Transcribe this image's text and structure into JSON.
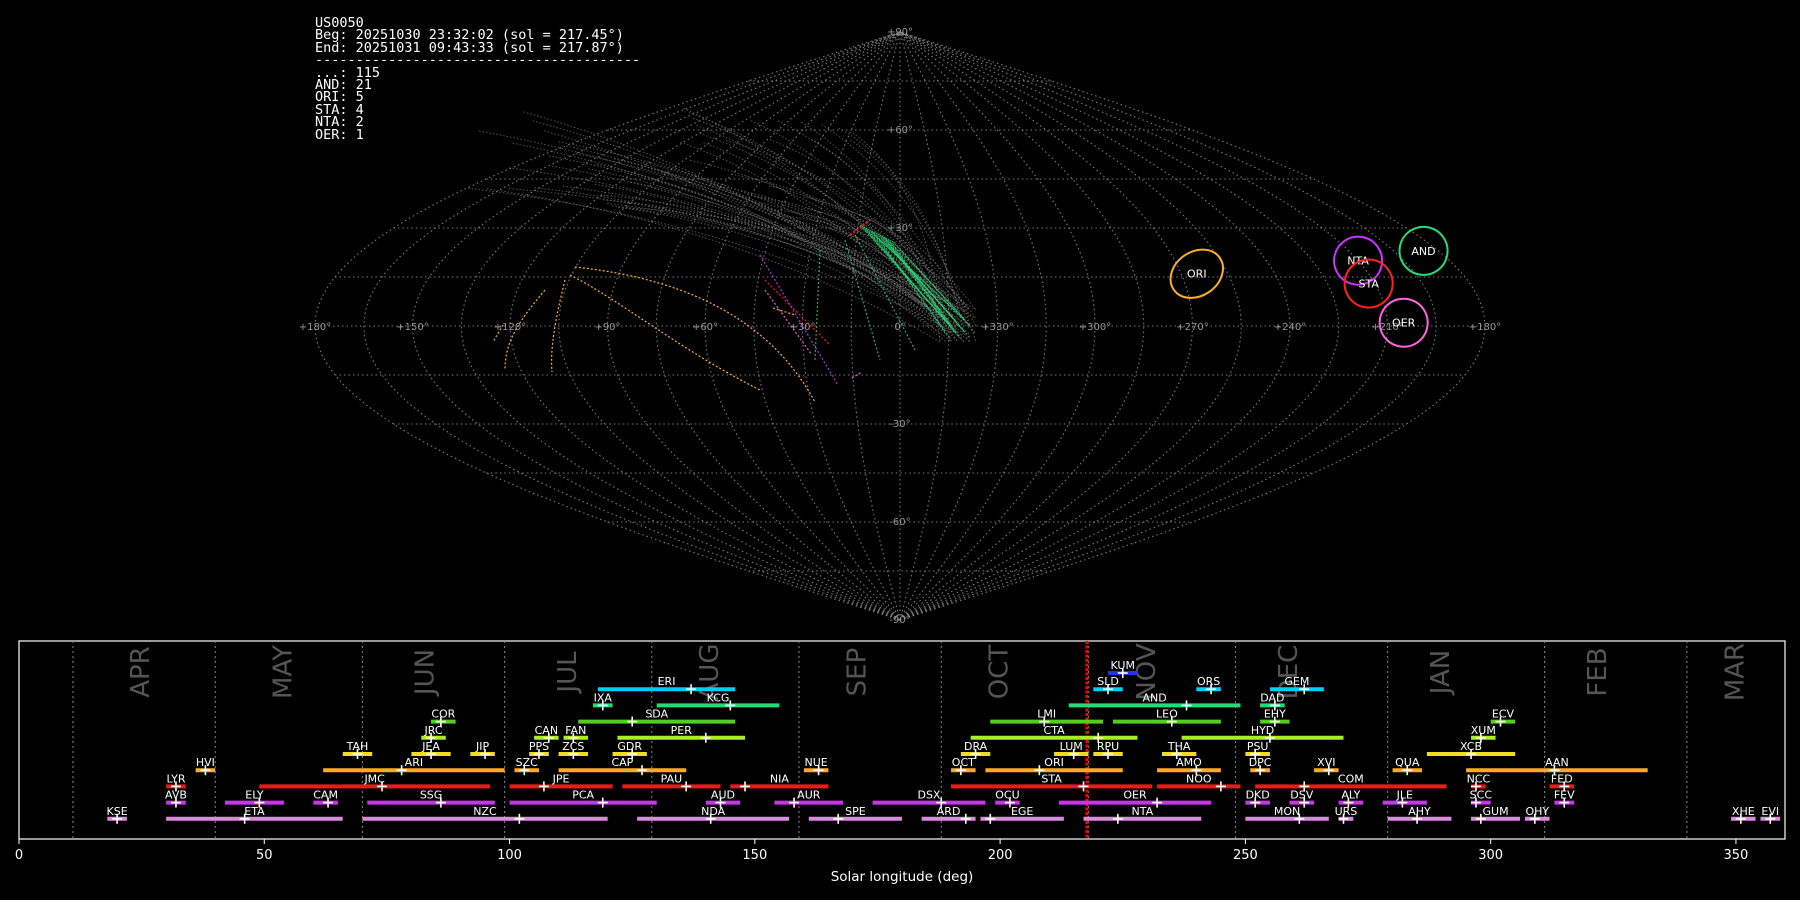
{
  "info_panel": {
    "station": "US0050",
    "begin": "Beg: 20251030 23:32:02 (sol = 217.45°)",
    "end": "End: 20251031 09:43:33 (sol = 217.87°)",
    "separator": "----------------------------------------",
    "counts": [
      {
        "code": "...",
        "count": 115
      },
      {
        "code": "AND",
        "count": 21
      },
      {
        "code": "ORI",
        "count": 5
      },
      {
        "code": "STA",
        "count": 4
      },
      {
        "code": "NTA",
        "count": 2
      },
      {
        "code": "OER",
        "count": 1
      }
    ]
  },
  "colors": {
    "background": "#000000",
    "grid": "#7a7a7a",
    "axis_text": "#ffffff",
    "month_label": "#555555",
    "current_marker": "#ff0000"
  },
  "sky_map": {
    "projection": "sinusoidal",
    "lon_ticks": [
      "+180°",
      "+150°",
      "+120°",
      "+90°",
      "+60°",
      "+30°",
      "0°",
      "+330°",
      "+300°",
      "+270°",
      "+240°",
      "+210°",
      "+180°"
    ],
    "lat_ticks": [
      "+90°",
      "+60°",
      "+30°",
      "-30°",
      "-60°",
      "-90°"
    ],
    "radiants": [
      {
        "code": "ORI",
        "color": "#ffb020",
        "lon": 100,
        "lat": 16,
        "r": 12
      },
      {
        "code": "NTA",
        "color": "#cc33ff",
        "lon": 45,
        "lat": 20,
        "r": 8
      },
      {
        "code": "STA",
        "color": "#ff2020",
        "lon": 47,
        "lat": 13,
        "r": 8
      },
      {
        "code": "AND",
        "color": "#22dd77",
        "lon": 20,
        "lat": 23,
        "r": 8
      },
      {
        "code": "OER",
        "color": "#ff66dd",
        "lon": 40,
        "lat": 1,
        "r": 8
      }
    ]
  },
  "chart_data": {
    "type": "bar",
    "title": "",
    "xlabel": "Solar longitude (deg)",
    "xlim": [
      0,
      360
    ],
    "x_ticks": [
      0,
      50,
      100,
      150,
      200,
      250,
      300,
      350
    ],
    "current_sol": 217.7,
    "months": [
      {
        "label": "APR",
        "x": 25
      },
      {
        "label": "MAY",
        "x": 54
      },
      {
        "label": "JUN",
        "x": 83
      },
      {
        "label": "JUL",
        "x": 112
      },
      {
        "label": "AUG",
        "x": 141
      },
      {
        "label": "SEP",
        "x": 171
      },
      {
        "label": "OCT",
        "x": 200
      },
      {
        "label": "NOV",
        "x": 230
      },
      {
        "label": "DEC",
        "x": 259
      },
      {
        "label": "JAN",
        "x": 290
      },
      {
        "label": "FEB",
        "x": 322
      },
      {
        "label": "MAR",
        "x": 350
      }
    ],
    "month_separators": [
      11,
      40,
      70,
      99,
      129,
      159,
      188,
      218,
      248,
      279,
      311,
      340
    ],
    "series": [
      {
        "name": "KUM",
        "start": 222,
        "end": 228,
        "peak": 225,
        "row": 10,
        "color": "#2233ee"
      },
      {
        "name": "ERI",
        "start": 118,
        "end": 146,
        "peak": 137,
        "row": 9,
        "color": "#00ccff"
      },
      {
        "name": "SLD",
        "start": 219,
        "end": 225,
        "peak": 222,
        "row": 9,
        "color": "#00ccff"
      },
      {
        "name": "ORS",
        "start": 240,
        "end": 245,
        "peak": 243,
        "row": 9,
        "color": "#00ccff"
      },
      {
        "name": "GEM",
        "start": 255,
        "end": 266,
        "peak": 262,
        "row": 9,
        "color": "#00ccff"
      },
      {
        "name": "IXA",
        "start": 117,
        "end": 121,
        "peak": 119,
        "row": 8,
        "color": "#22dd77"
      },
      {
        "name": "KCG",
        "start": 130,
        "end": 155,
        "peak": 145,
        "row": 8,
        "color": "#22dd77"
      },
      {
        "name": "AND",
        "start": 214,
        "end": 249,
        "peak": 238,
        "row": 8,
        "color": "#22dd77"
      },
      {
        "name": "DAD",
        "start": 253,
        "end": 258,
        "peak": 256,
        "row": 8,
        "color": "#22dd77"
      },
      {
        "name": "COR",
        "start": 84,
        "end": 89,
        "peak": 86,
        "row": 7,
        "color": "#55cc22"
      },
      {
        "name": "SDA",
        "start": 114,
        "end": 146,
        "peak": 125,
        "row": 7,
        "color": "#55cc22"
      },
      {
        "name": "LMI",
        "start": 198,
        "end": 221,
        "peak": 209,
        "row": 7,
        "color": "#55cc22"
      },
      {
        "name": "LEO",
        "start": 223,
        "end": 245,
        "peak": 235,
        "row": 7,
        "color": "#55cc22"
      },
      {
        "name": "EHY",
        "start": 253,
        "end": 259,
        "peak": 256,
        "row": 7,
        "color": "#55cc22"
      },
      {
        "name": "ECV",
        "start": 300,
        "end": 305,
        "peak": 302,
        "row": 7,
        "color": "#55cc22"
      },
      {
        "name": "JRC",
        "start": 82,
        "end": 87,
        "peak": 84,
        "row": 6,
        "color": "#aaee22"
      },
      {
        "name": "CAN",
        "start": 105,
        "end": 110,
        "peak": 108,
        "row": 6,
        "color": "#aaee22"
      },
      {
        "name": "FAN",
        "start": 111,
        "end": 116,
        "peak": 113,
        "row": 6,
        "color": "#aaee22"
      },
      {
        "name": "PER",
        "start": 122,
        "end": 148,
        "peak": 140,
        "row": 6,
        "color": "#aaee22"
      },
      {
        "name": "CTA",
        "start": 194,
        "end": 228,
        "peak": 220,
        "row": 6,
        "color": "#aaee22"
      },
      {
        "name": "HYD",
        "start": 237,
        "end": 270,
        "peak": 255,
        "row": 6,
        "color": "#aaee22"
      },
      {
        "name": "XUM",
        "start": 296,
        "end": 301,
        "peak": 298,
        "row": 6,
        "color": "#aaee22"
      },
      {
        "name": "TAH",
        "start": 66,
        "end": 72,
        "peak": 69,
        "row": 5,
        "color": "#eedd22"
      },
      {
        "name": "JEA",
        "start": 80,
        "end": 88,
        "peak": 84,
        "row": 5,
        "color": "#eedd22"
      },
      {
        "name": "JIP",
        "start": 92,
        "end": 97,
        "peak": 95,
        "row": 5,
        "color": "#eedd22"
      },
      {
        "name": "PPS",
        "start": 104,
        "end": 108,
        "peak": 106,
        "row": 5,
        "color": "#eedd22"
      },
      {
        "name": "ZCS",
        "start": 110,
        "end": 116,
        "peak": 113,
        "row": 5,
        "color": "#eedd22"
      },
      {
        "name": "GDR",
        "start": 121,
        "end": 128,
        "peak": 125,
        "row": 5,
        "color": "#eedd22"
      },
      {
        "name": "DRA",
        "start": 192,
        "end": 198,
        "peak": 195,
        "row": 5,
        "color": "#eedd22"
      },
      {
        "name": "LUM",
        "start": 211,
        "end": 218,
        "peak": 215,
        "row": 5,
        "color": "#eedd22"
      },
      {
        "name": "RPU",
        "start": 219,
        "end": 225,
        "peak": 222,
        "row": 5,
        "color": "#eedd22"
      },
      {
        "name": "THA",
        "start": 233,
        "end": 240,
        "peak": 236,
        "row": 5,
        "color": "#eedd22"
      },
      {
        "name": "PSU",
        "start": 250,
        "end": 255,
        "peak": 252,
        "row": 5,
        "color": "#eedd22"
      },
      {
        "name": "XCB",
        "start": 287,
        "end": 305,
        "peak": 296,
        "row": 5,
        "color": "#eedd22"
      },
      {
        "name": "HVI",
        "start": 36,
        "end": 40,
        "peak": 38,
        "row": 4,
        "color": "#ffaa22"
      },
      {
        "name": "ARI",
        "start": 62,
        "end": 99,
        "peak": 78,
        "row": 4,
        "color": "#ffaa22"
      },
      {
        "name": "SZC",
        "start": 101,
        "end": 106,
        "peak": 103,
        "row": 4,
        "color": "#ffaa22"
      },
      {
        "name": "CAP",
        "start": 110,
        "end": 136,
        "peak": 127,
        "row": 4,
        "color": "#ffaa22"
      },
      {
        "name": "NUE",
        "start": 160,
        "end": 165,
        "peak": 163,
        "row": 4,
        "color": "#ffaa22"
      },
      {
        "name": "OCT",
        "start": 190,
        "end": 195,
        "peak": 192,
        "row": 4,
        "color": "#ffaa22"
      },
      {
        "name": "ORI",
        "start": 197,
        "end": 225,
        "peak": 208,
        "row": 4,
        "color": "#ffaa22"
      },
      {
        "name": "AMO",
        "start": 232,
        "end": 245,
        "peak": 240,
        "row": 4,
        "color": "#ffaa22"
      },
      {
        "name": "DPC",
        "start": 251,
        "end": 255,
        "peak": 253,
        "row": 4,
        "color": "#ffaa22"
      },
      {
        "name": "XVI",
        "start": 264,
        "end": 269,
        "peak": 267,
        "row": 4,
        "color": "#ffaa22"
      },
      {
        "name": "QUA",
        "start": 280,
        "end": 286,
        "peak": 283,
        "row": 4,
        "color": "#ffaa22"
      },
      {
        "name": "AAN",
        "start": 295,
        "end": 332,
        "peak": 313,
        "row": 4,
        "color": "#ffaa22"
      },
      {
        "name": "LYR",
        "start": 30,
        "end": 34,
        "peak": 32,
        "row": 3,
        "color": "#ee1a1a"
      },
      {
        "name": "JMC",
        "start": 49,
        "end": 96,
        "peak": 74,
        "row": 3,
        "color": "#ee1a1a"
      },
      {
        "name": "JPE",
        "start": 100,
        "end": 121,
        "peak": 107,
        "row": 3,
        "color": "#ee1a1a"
      },
      {
        "name": "PAU",
        "start": 123,
        "end": 143,
        "peak": 136,
        "row": 3,
        "color": "#ee1a1a"
      },
      {
        "name": "NIA",
        "start": 145,
        "end": 165,
        "peak": 148,
        "row": 3,
        "color": "#ee1a1a"
      },
      {
        "name": "STA",
        "start": 190,
        "end": 231,
        "peak": 217,
        "row": 3,
        "color": "#ee1a1a"
      },
      {
        "name": "NOO",
        "start": 232,
        "end": 249,
        "peak": 245,
        "row": 3,
        "color": "#ee1a1a"
      },
      {
        "name": "COM",
        "start": 252,
        "end": 291,
        "peak": 262,
        "row": 3,
        "color": "#ee1a1a"
      },
      {
        "name": "NCC",
        "start": 296,
        "end": 299,
        "peak": 297,
        "row": 3,
        "color": "#ee1a1a"
      },
      {
        "name": "FED",
        "start": 312,
        "end": 317,
        "peak": 315,
        "row": 3,
        "color": "#ee1a1a"
      },
      {
        "name": "AVB",
        "start": 30,
        "end": 34,
        "peak": 32,
        "row": 2,
        "color": "#cc33ee"
      },
      {
        "name": "ELY",
        "start": 42,
        "end": 54,
        "peak": 49,
        "row": 2,
        "color": "#cc33ee"
      },
      {
        "name": "CAM",
        "start": 60,
        "end": 65,
        "peak": 63,
        "row": 2,
        "color": "#cc33ee"
      },
      {
        "name": "SSG",
        "start": 71,
        "end": 97,
        "peak": 86,
        "row": 2,
        "color": "#cc33ee"
      },
      {
        "name": "PCA",
        "start": 100,
        "end": 130,
        "peak": 119,
        "row": 2,
        "color": "#cc33ee"
      },
      {
        "name": "AUD",
        "start": 140,
        "end": 147,
        "peak": 143,
        "row": 2,
        "color": "#cc33ee"
      },
      {
        "name": "AUR",
        "start": 154,
        "end": 168,
        "peak": 158,
        "row": 2,
        "color": "#cc33ee"
      },
      {
        "name": "DSX",
        "start": 174,
        "end": 197,
        "peak": 188,
        "row": 2,
        "color": "#cc33ee"
      },
      {
        "name": "OCU",
        "start": 199,
        "end": 204,
        "peak": 202,
        "row": 2,
        "color": "#cc33ee"
      },
      {
        "name": "OER",
        "start": 212,
        "end": 243,
        "peak": 232,
        "row": 2,
        "color": "#cc33ee"
      },
      {
        "name": "DKD",
        "start": 250,
        "end": 255,
        "peak": 252,
        "row": 2,
        "color": "#cc33ee"
      },
      {
        "name": "DSV",
        "start": 259,
        "end": 264,
        "peak": 262,
        "row": 2,
        "color": "#cc33ee"
      },
      {
        "name": "ALY",
        "start": 269,
        "end": 274,
        "peak": 271,
        "row": 2,
        "color": "#cc33ee"
      },
      {
        "name": "JLE",
        "start": 278,
        "end": 287,
        "peak": 282,
        "row": 2,
        "color": "#cc33ee"
      },
      {
        "name": "SCC",
        "start": 296,
        "end": 300,
        "peak": 297,
        "row": 2,
        "color": "#cc33ee"
      },
      {
        "name": "FEV",
        "start": 313,
        "end": 317,
        "peak": 315,
        "row": 2,
        "color": "#cc33ee"
      },
      {
        "name": "KSE",
        "start": 18,
        "end": 22,
        "peak": 20,
        "row": 1,
        "color": "#dd88dd"
      },
      {
        "name": "ETA",
        "start": 30,
        "end": 66,
        "peak": 46,
        "row": 1,
        "color": "#dd88dd"
      },
      {
        "name": "NZC",
        "start": 70,
        "end": 120,
        "peak": 102,
        "row": 1,
        "color": "#dd88dd"
      },
      {
        "name": "NDA",
        "start": 126,
        "end": 157,
        "peak": 141,
        "row": 1,
        "color": "#dd88dd"
      },
      {
        "name": "SPE",
        "start": 161,
        "end": 180,
        "peak": 167,
        "row": 1,
        "color": "#dd88dd"
      },
      {
        "name": "ARD",
        "start": 184,
        "end": 195,
        "peak": 193,
        "row": 1,
        "color": "#dd88dd"
      },
      {
        "name": "EGE",
        "start": 196,
        "end": 213,
        "peak": 198,
        "row": 1,
        "color": "#dd88dd"
      },
      {
        "name": "NTA",
        "start": 217,
        "end": 241,
        "peak": 224,
        "row": 1,
        "color": "#dd88dd"
      },
      {
        "name": "MON",
        "start": 250,
        "end": 267,
        "peak": 261,
        "row": 1,
        "color": "#dd88dd"
      },
      {
        "name": "URS",
        "start": 269,
        "end": 272,
        "peak": 270,
        "row": 1,
        "color": "#dd88dd"
      },
      {
        "name": "AHY",
        "start": 279,
        "end": 292,
        "peak": 285,
        "row": 1,
        "color": "#dd88dd"
      },
      {
        "name": "GUM",
        "start": 296,
        "end": 306,
        "peak": 298,
        "row": 1,
        "color": "#dd88dd"
      },
      {
        "name": "OHY",
        "start": 307,
        "end": 312,
        "peak": 309,
        "row": 1,
        "color": "#dd88dd"
      },
      {
        "name": "XHE",
        "start": 349,
        "end": 354,
        "peak": 351,
        "row": 1,
        "color": "#dd88dd"
      },
      {
        "name": "EVI",
        "start": 355,
        "end": 359,
        "peak": 357,
        "row": 1,
        "color": "#dd88dd"
      }
    ]
  }
}
